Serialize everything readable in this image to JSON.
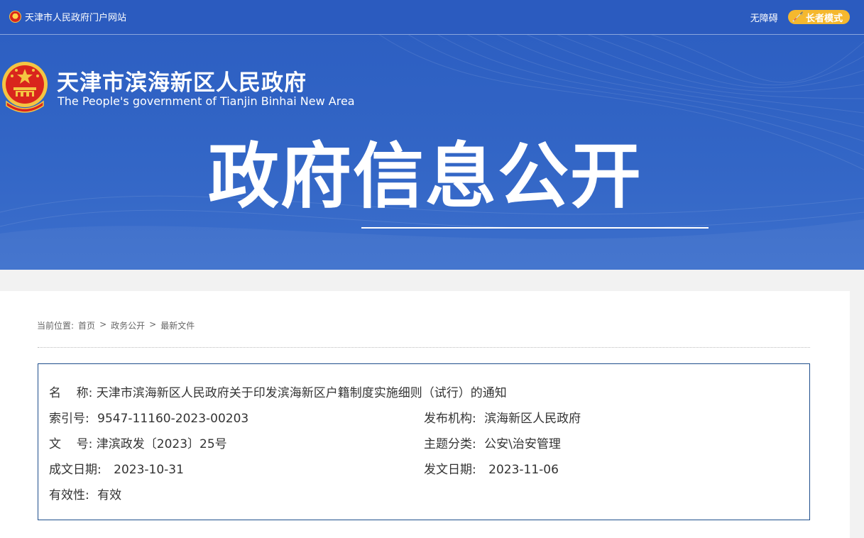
{
  "topbar": {
    "site_portal": "天津市人民政府门户网站",
    "accessibility": "无障碍",
    "elder_mode": "长者模式"
  },
  "banner": {
    "title_cn": "天津市滨海新区人民政府",
    "title_en": "The People's government of Tianjin Binhai New Area",
    "hero": "政府信息公开"
  },
  "breadcrumb": {
    "prefix": "当前位置:",
    "items": [
      "首页",
      "政务公开",
      "最新文件"
    ],
    "separator": ">"
  },
  "info": {
    "name_label": "名    称:",
    "name_value": "天津市滨海新区人民政府关于印发滨海新区户籍制度实施细则（试行）的通知",
    "index_label": "索引号:",
    "index_value": "9547-11160-2023-00203",
    "publisher_label": "发布机构:",
    "publisher_value": "滨海新区人民政府",
    "doc_no_label": "文    号:",
    "doc_no_value": "津滨政发〔2023〕25号",
    "topic_label": "主题分类:",
    "topic_value": "公安\\治安管理",
    "created_label": "成文日期:",
    "created_value": "2023-10-31",
    "issued_label": "发文日期:",
    "issued_value": "2023-11-06",
    "validity_label": "有效性:",
    "validity_value": "有效"
  },
  "colors": {
    "banner_blue": "#2d5fc2",
    "elder_btn": "#f5b82e",
    "info_border": "#1f4e8c"
  }
}
